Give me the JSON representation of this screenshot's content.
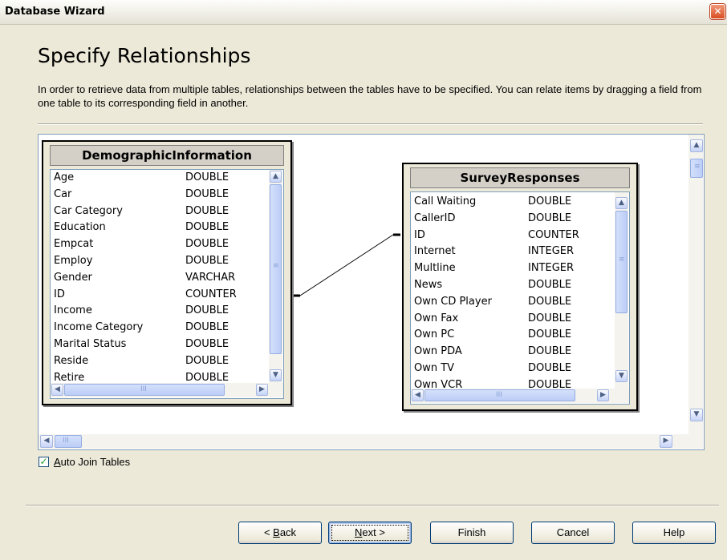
{
  "window": {
    "title": "Database Wizard"
  },
  "page": {
    "heading": "Specify Relationships",
    "description": "In order to retrieve data from multiple tables, relationships between the tables have to be specified. You can relate items by dragging a field from one table to its corresponding field in another."
  },
  "tables": [
    {
      "name": "DemographicInformation",
      "fields": [
        {
          "name": "Age",
          "type": "DOUBLE"
        },
        {
          "name": "Car",
          "type": "DOUBLE"
        },
        {
          "name": "Car Category",
          "type": "DOUBLE"
        },
        {
          "name": "Education",
          "type": "DOUBLE"
        },
        {
          "name": "Empcat",
          "type": "DOUBLE"
        },
        {
          "name": "Employ",
          "type": "DOUBLE"
        },
        {
          "name": "Gender",
          "type": "VARCHAR"
        },
        {
          "name": "ID",
          "type": "COUNTER"
        },
        {
          "name": "Income",
          "type": "DOUBLE"
        },
        {
          "name": "Income Category",
          "type": "DOUBLE"
        },
        {
          "name": "Marital Status",
          "type": "DOUBLE"
        },
        {
          "name": "Reside",
          "type": "DOUBLE"
        },
        {
          "name": "Retire",
          "type": "DOUBLE"
        }
      ]
    },
    {
      "name": "SurveyResponses",
      "fields": [
        {
          "name": "Call Waiting",
          "type": "DOUBLE"
        },
        {
          "name": "CallerID",
          "type": "DOUBLE"
        },
        {
          "name": "ID",
          "type": "COUNTER"
        },
        {
          "name": "Internet",
          "type": "INTEGER"
        },
        {
          "name": "Multline",
          "type": "INTEGER"
        },
        {
          "name": "News",
          "type": "DOUBLE"
        },
        {
          "name": "Own CD Player",
          "type": "DOUBLE"
        },
        {
          "name": "Own Fax",
          "type": "DOUBLE"
        },
        {
          "name": "Own PC",
          "type": "DOUBLE"
        },
        {
          "name": "Own PDA",
          "type": "DOUBLE"
        },
        {
          "name": "Own TV",
          "type": "DOUBLE"
        },
        {
          "name": "Own VCR",
          "type": "DOUBLE"
        }
      ]
    }
  ],
  "auto_join": {
    "label": "Auto Join Tables",
    "checked": true
  },
  "buttons": {
    "back": "< Back",
    "next": "Next >",
    "finish": "Finish",
    "cancel": "Cancel",
    "help": "Help"
  }
}
